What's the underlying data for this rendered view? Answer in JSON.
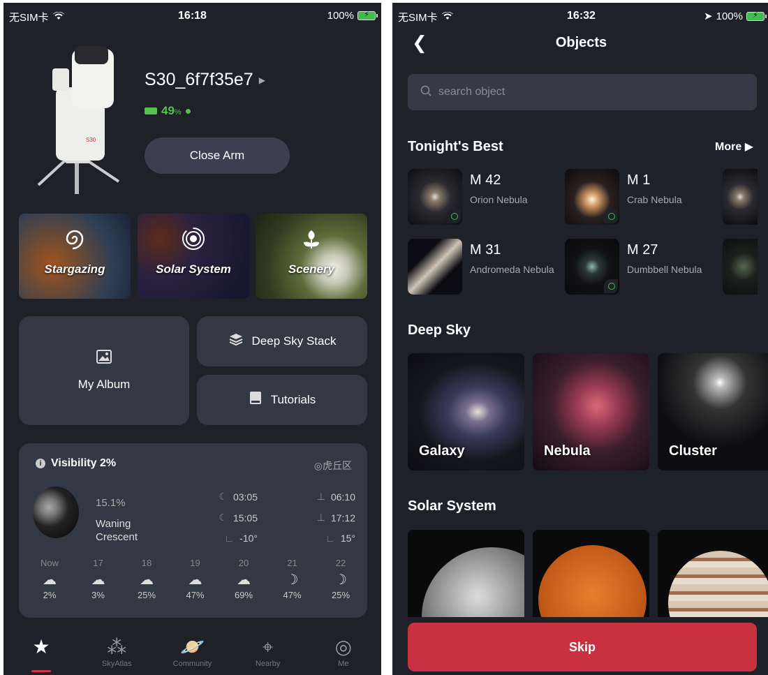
{
  "left": {
    "status": {
      "carrier": "无SIM卡",
      "time": "16:18",
      "battery": "100%"
    },
    "device": {
      "name": "S30_6f7f35e7",
      "battery_value": "49",
      "battery_unit": "%"
    },
    "close_arm_label": "Close Arm",
    "modes": [
      {
        "label": "Stargazing",
        "icon": "spiral-galaxy-icon"
      },
      {
        "label": "Solar System",
        "icon": "orbit-icon"
      },
      {
        "label": "Scenery",
        "icon": "flower-icon"
      }
    ],
    "tiles": {
      "album": "My Album",
      "stack": "Deep Sky Stack",
      "tutorials": "Tutorials"
    },
    "weather": {
      "title": "Visibility 2%",
      "location": "虎丘区",
      "moon_percent": "15.1%",
      "moon_phase": "Waning Crescent",
      "moonrise": "03:05",
      "moonset": "15:05",
      "moon_alt": "-10°",
      "sunrise": "06:10",
      "sunset": "17:12",
      "sun_alt": "15°",
      "forecast": [
        {
          "hour": "Now",
          "value": "2%",
          "icon": "cloud-icon"
        },
        {
          "hour": "17",
          "value": "3%",
          "icon": "cloud-icon"
        },
        {
          "hour": "18",
          "value": "25%",
          "icon": "cloud-icon"
        },
        {
          "hour": "19",
          "value": "47%",
          "icon": "cloud-icon"
        },
        {
          "hour": "20",
          "value": "69%",
          "icon": "cloud-icon"
        },
        {
          "hour": "21",
          "value": "47%",
          "icon": "moon-cloud-icon"
        },
        {
          "hour": "22",
          "value": "25%",
          "icon": "moon-cloud-icon"
        }
      ]
    },
    "tabs": [
      {
        "label": "",
        "icon": "home-star-icon",
        "active": true
      },
      {
        "label": "SkyAtlas",
        "icon": "constellation-icon"
      },
      {
        "label": "Community",
        "icon": "planet-icon"
      },
      {
        "label": "Nearby",
        "icon": "location-pin-icon"
      },
      {
        "label": "Me",
        "icon": "profile-icon"
      }
    ]
  },
  "right": {
    "status": {
      "carrier": "无SIM卡",
      "time": "16:32",
      "battery": "100%"
    },
    "title": "Objects",
    "search": {
      "placeholder": "search object"
    },
    "tonights_best": {
      "title": "Tonight's Best",
      "more": "More",
      "items": [
        {
          "code": "M 42",
          "name": "Orion Nebula",
          "badge": true
        },
        {
          "code": "M 1",
          "name": "Crab Nebula",
          "badge": true
        },
        {
          "code": "M 31",
          "name": "Andromeda Nebula",
          "badge": false
        },
        {
          "code": "M 27",
          "name": "Dumbbell Nebula",
          "badge": true
        }
      ]
    },
    "deep_sky": {
      "title": "Deep Sky",
      "items": [
        "Galaxy",
        "Nebula",
        "Cluster"
      ]
    },
    "solar_system": {
      "title": "Solar System"
    },
    "skip": "Skip",
    "colors": {
      "accent": "#c93040",
      "background": "#1f2129",
      "card": "#333845",
      "green": "#54c24d"
    }
  }
}
